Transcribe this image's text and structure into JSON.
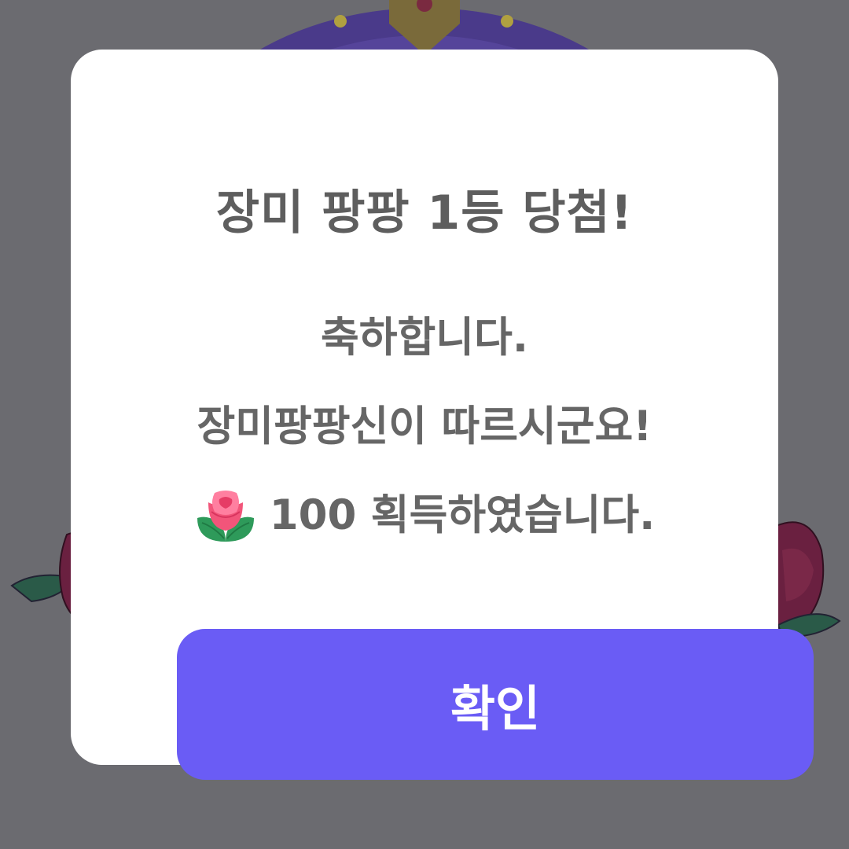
{
  "colors": {
    "backdrop": "#6b6b70",
    "dialog_background": "#ffffff",
    "title_text": "#5e5e5e",
    "message_text": "#666666",
    "button_background": "#6a5cf5",
    "button_text": "#ffffff"
  },
  "dialog": {
    "title": "장미 팡팡 1등 당첨!",
    "message_line_1": "축하합니다.",
    "message_line_2": "장미팡팡신이 따르시군요!",
    "reward_icon": "rose-icon",
    "reward_text": "100 획득하였습니다.",
    "confirm_label": "확인"
  }
}
